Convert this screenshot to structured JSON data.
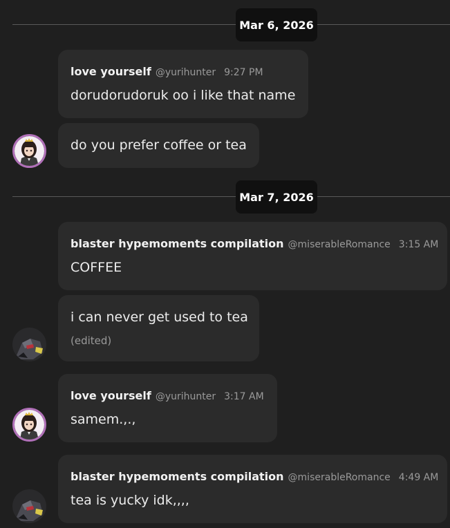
{
  "dates": {
    "first": "Mar 6, 2026",
    "second": "Mar 7, 2026"
  },
  "users": {
    "love": {
      "name": "love yourself",
      "handle": "@yurihunter",
      "avatar_icon": "anime-girl-avatar-icon"
    },
    "blaster": {
      "name": "blaster hypemoments compilation",
      "handle": "@miserableRomance",
      "avatar_icon": "robot-avatar-icon"
    }
  },
  "messages": {
    "m1": {
      "time": "9:27 PM",
      "text": "dorudorudoruk oo i like that name"
    },
    "m2": {
      "text": "do you prefer coffee or tea"
    },
    "m3": {
      "time": "3:15 AM",
      "text": "COFFEE"
    },
    "m4": {
      "text": "i can never get used to tea",
      "edited": "(edited)"
    },
    "m5": {
      "time": "3:17 AM",
      "text": "samem.,.,"
    },
    "m6": {
      "time": "4:49 AM",
      "text": "tea is yucky idk,,,,"
    }
  }
}
